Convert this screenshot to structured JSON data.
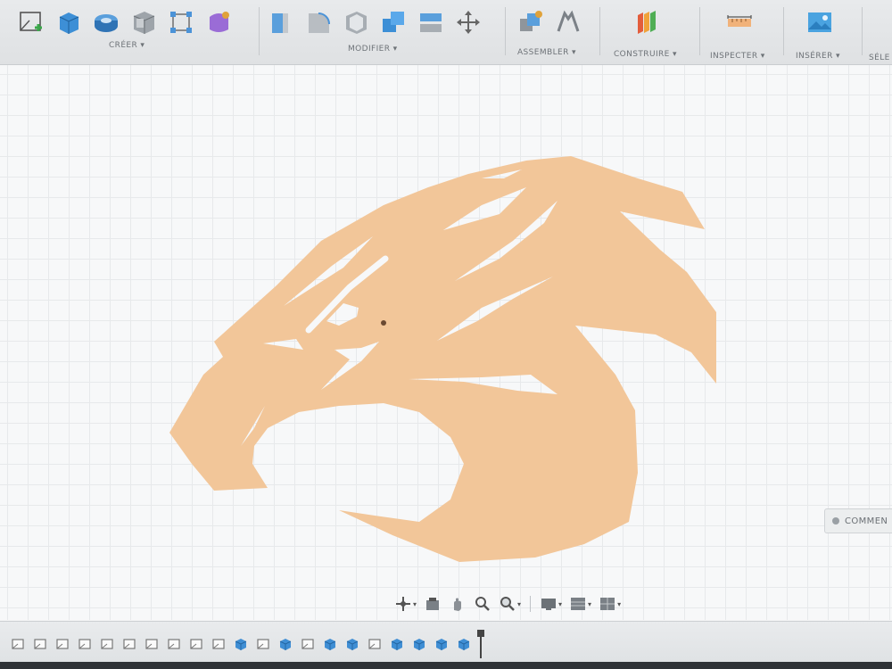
{
  "toolbar": {
    "groups": [
      {
        "label": "CRÉER ▾",
        "icons": [
          "sketch-icon",
          "extrude-icon",
          "revolve-icon",
          "box-icon",
          "polygon-icon",
          "form-icon"
        ]
      },
      {
        "label": "MODIFIER ▾",
        "icons": [
          "press-pull-icon",
          "fillet-icon",
          "shell-icon",
          "combine-icon",
          "split-icon",
          "move-icon"
        ]
      },
      {
        "label": "ASSEMBLER ▾",
        "icons": [
          "new-component-icon",
          "joint-icon"
        ]
      },
      {
        "label": "CONSTRUIRE ▾",
        "icons": [
          "offset-plane-icon"
        ]
      },
      {
        "label": "INSPECTER ▾",
        "icons": [
          "measure-icon"
        ]
      },
      {
        "label": "INSÉRER ▾",
        "icons": [
          "insert-image-icon"
        ]
      },
      {
        "label": "SÉLE",
        "icons": []
      }
    ]
  },
  "canvas": {
    "sketch_fill": "#f2c699",
    "grid_color": "#d6d8db"
  },
  "comments": {
    "label": "COMMEN"
  },
  "navbar": {
    "icons": [
      "orbit-icon",
      "look-at-icon",
      "pan-icon",
      "zoom-icon",
      "zoom-window-icon",
      "display-settings-icon",
      "grid-settings-icon",
      "viewports-icon"
    ]
  },
  "timeline": {
    "items": [
      "sketch",
      "sketch",
      "sketch",
      "sketch",
      "sketch",
      "sketch",
      "sketch",
      "sketch",
      "sketch",
      "sketch",
      "body",
      "sketch",
      "body",
      "sketch",
      "body",
      "body",
      "sketch",
      "body",
      "body",
      "body",
      "body"
    ],
    "marker_color": "#444444"
  }
}
